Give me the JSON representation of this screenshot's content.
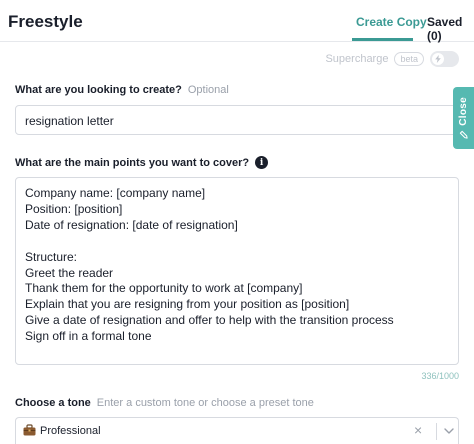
{
  "header": {
    "title": "Freestyle",
    "tabs": [
      {
        "label": "Create Copy",
        "active": true
      },
      {
        "label": "Saved (0)",
        "active": false
      }
    ]
  },
  "supercharge": {
    "label": "Supercharge",
    "badge": "beta",
    "enabled": false,
    "icon": "lightning-icon"
  },
  "create_field": {
    "label": "What are you looking to create?",
    "hint": "Optional",
    "value": "resignation letter"
  },
  "points_field": {
    "label": "What are the main points you want to cover?",
    "info_icon": "i",
    "value": "Company name: [company name]\nPosition: [position]\nDate of resignation: [date of resignation]\n\nStructure:\nGreet the reader\nThank them for the opportunity to work at [company]\nExplain that you are resigning from your position as [position]\nGive a date of resignation and offer to help with the transition process\nSign off in a formal tone",
    "char_count": "336/1000"
  },
  "tone_field": {
    "label": "Choose a tone",
    "placeholder": "Enter a custom tone or choose a preset tone",
    "selected": "Professional",
    "clear_glyph": "×",
    "emoji": "briefcase-icon"
  },
  "side_tab": {
    "label": "Close",
    "icon": "pencil-icon"
  },
  "colors": {
    "accent": "#3b9a94",
    "side_tab": "#56b9b1",
    "border": "#d7dae0"
  }
}
